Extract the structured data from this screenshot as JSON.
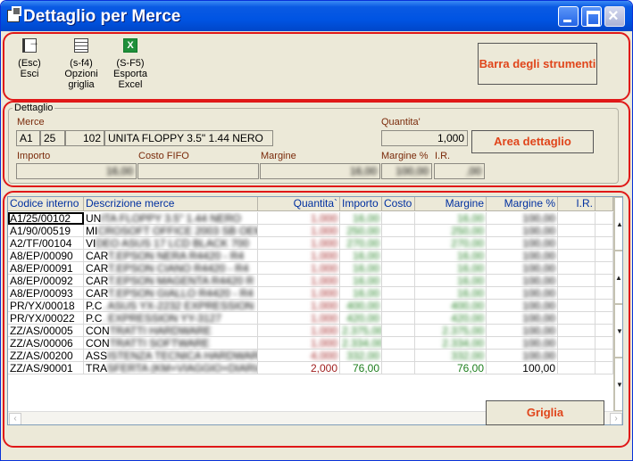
{
  "window": {
    "title": "Dettaglio per Merce"
  },
  "toolbar": {
    "exit": {
      "line1": "(Esc)",
      "line2": "Esci"
    },
    "grid_options": {
      "line1": "(s-f4)",
      "line2": "Opzioni",
      "line3": "griglia"
    },
    "export": {
      "line1": "(S-F5)",
      "line2": "Esporta",
      "line3": "Excel"
    }
  },
  "callouts": {
    "toolbar": "Barra degli strumenti",
    "detail": "Area dettaglio",
    "grid": "Griglia"
  },
  "detail": {
    "legend": "Dettaglio",
    "merce_label": "Merce",
    "merce_code1": "A1",
    "merce_code2": "25",
    "merce_code3": "102",
    "merce_desc": "UNITA FLOPPY 3.5\" 1.44 NERO",
    "quantita_label": "Quantita'",
    "quantita_value": "1,000",
    "importo_label": "Importo",
    "importo_value": "16,00",
    "costo_label": "Costo FIFO",
    "costo_value": "",
    "margine_label": "Margine",
    "margine_value": "16,00",
    "margine_perc_label": "Margine %",
    "margine_perc_value": "100,00",
    "ir_label": "I.R.",
    "ir_value": ",00"
  },
  "grid": {
    "headers": [
      "Codice interno",
      "Descrizione merce",
      "Quantita`",
      "Importo",
      "Costo",
      "Margine",
      "Margine %",
      "I.R."
    ],
    "rows": [
      {
        "code": "A1/25/00102",
        "desc": "UNITA FLOPPY 3.5\" 1.44 NERO",
        "qty": "1,000",
        "imp": "16,00",
        "cost": "",
        "marg": "16,00",
        "margp": "100,00",
        "ir": ""
      },
      {
        "code": "A1/90/00519",
        "desc": "MICROSOFT OFFICE 2003 SB OEM",
        "qty": "1,000",
        "imp": "250,00",
        "cost": "",
        "marg": "250,00",
        "margp": "100,00",
        "ir": ""
      },
      {
        "code": "A2/TF/00104",
        "desc": "VIDEO ASUS 17 LCD BLACK 700",
        "qty": "1,000",
        "imp": "270,00",
        "cost": "",
        "marg": "270,00",
        "margp": "100,00",
        "ir": ""
      },
      {
        "code": "A8/EP/00090",
        "desc": "CART.EPSON NERA R4420 - R4",
        "qty": "1,000",
        "imp": "16,00",
        "cost": "",
        "marg": "16,00",
        "margp": "100,00",
        "ir": ""
      },
      {
        "code": "A8/EP/00091",
        "desc": "CART.EPSON CIANO R4420 - R4",
        "qty": "1,000",
        "imp": "16,00",
        "cost": "",
        "marg": "16,00",
        "margp": "100,00",
        "ir": ""
      },
      {
        "code": "A8/EP/00092",
        "desc": "CART.EPSON MAGENTA R4420 R",
        "qty": "1,000",
        "imp": "16,00",
        "cost": "",
        "marg": "16,00",
        "margp": "100,00",
        "ir": ""
      },
      {
        "code": "A8/EP/00093",
        "desc": "CART.EPSON GIALLO R4420 - R4",
        "qty": "1,000",
        "imp": "16,00",
        "cost": "",
        "marg": "16,00",
        "margp": "100,00",
        "ir": ""
      },
      {
        "code": "PR/YX/00018",
        "desc": "P.C. ASUS YX-2232 EXPRESSION",
        "qty": "1,000",
        "imp": "400,00",
        "cost": "",
        "marg": "400,00",
        "margp": "100,00",
        "ir": ""
      },
      {
        "code": "PR/YX/00022",
        "desc": "P.C. EXPRESSION YY-3127",
        "qty": "1,000",
        "imp": "420,00",
        "cost": "",
        "marg": "420,00",
        "margp": "100,00",
        "ir": ""
      },
      {
        "code": "ZZ/AS/00005",
        "desc": "CONTRATTI HARDWARE",
        "qty": "1,000",
        "imp": "2.375,00",
        "cost": "",
        "marg": "2.375,00",
        "margp": "100,00",
        "ir": ""
      },
      {
        "code": "ZZ/AS/00006",
        "desc": "CONTRATTI SOFTWARE",
        "qty": "1,000",
        "imp": "2.334,00",
        "cost": "",
        "marg": "2.334,00",
        "margp": "100,00",
        "ir": ""
      },
      {
        "code": "ZZ/AS/00200",
        "desc": "ASSISTENZA TECNICA HARDWARE",
        "qty": "4,000",
        "imp": "332,00",
        "cost": "",
        "marg": "332,00",
        "margp": "100,00",
        "ir": ""
      },
      {
        "code": "ZZ/AS/90001",
        "desc": "TRASFERTA (KM+VIAGGIO+DIARIA)",
        "qty": "2,000",
        "imp": "76,00",
        "cost": "",
        "marg": "76,00",
        "margp": "100,00",
        "ir": ""
      }
    ]
  },
  "icons": {
    "exit": "exit-door-icon",
    "grid": "grid-options-icon",
    "excel": "excel-icon"
  },
  "colors": {
    "annotation": "#e01818",
    "callout_text": "#e0451b",
    "titlebar": "#0054e3"
  }
}
